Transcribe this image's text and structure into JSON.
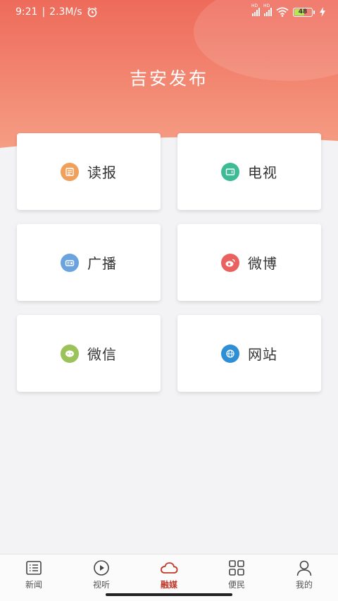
{
  "status_bar": {
    "time": "9:21",
    "separator": "|",
    "network_speed": "2.3M/s",
    "signal_tag_1": "HD",
    "signal_tag_2": "HD",
    "battery_level": "48",
    "icons": [
      "alarm-icon",
      "signal-icon",
      "wifi-icon",
      "battery-icon",
      "charging-icon"
    ]
  },
  "header": {
    "title": "吉安发布",
    "gradient_top": "#ef6a5a",
    "gradient_bottom": "#f7a085"
  },
  "grid": {
    "items": [
      {
        "label": "读报",
        "icon": "newspaper-icon",
        "color": "#f0a05a"
      },
      {
        "label": "电视",
        "icon": "tv-icon",
        "color": "#3dbb95"
      },
      {
        "label": "广播",
        "icon": "radio-icon",
        "color": "#6aa3e0"
      },
      {
        "label": "微博",
        "icon": "weibo-icon",
        "color": "#e9625f"
      },
      {
        "label": "微信",
        "icon": "wechat-icon",
        "color": "#9cc25a"
      },
      {
        "label": "网站",
        "icon": "globe-icon",
        "color": "#2e8fd4"
      }
    ]
  },
  "tabbar": {
    "tabs": [
      {
        "label": "新闻",
        "icon": "list-icon"
      },
      {
        "label": "视听",
        "icon": "play-icon"
      },
      {
        "label": "融媒",
        "icon": "cloud-icon",
        "active": true
      },
      {
        "label": "便民",
        "icon": "apps-grid-icon"
      },
      {
        "label": "我的",
        "icon": "person-icon"
      }
    ],
    "active_color": "#c0392b"
  }
}
